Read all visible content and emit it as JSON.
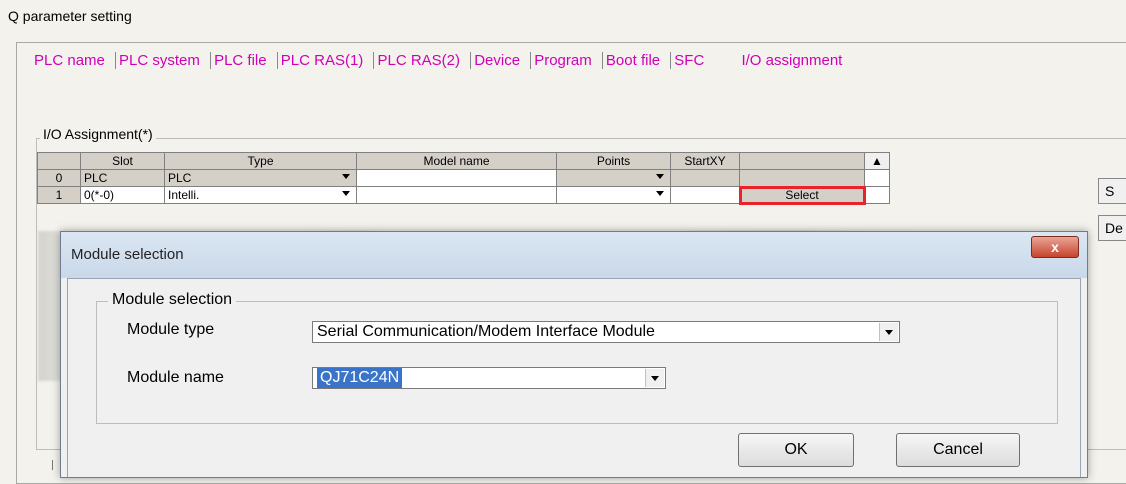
{
  "window": {
    "title": "Q parameter setting"
  },
  "tabs": [
    {
      "label": "PLC name"
    },
    {
      "label": "PLC system"
    },
    {
      "label": "PLC file"
    },
    {
      "label": "PLC RAS(1)"
    },
    {
      "label": "PLC RAS(2)"
    },
    {
      "label": "Device"
    },
    {
      "label": "Program"
    },
    {
      "label": "Boot file"
    },
    {
      "label": "SFC"
    },
    {
      "label": "I/O assignment"
    }
  ],
  "io": {
    "group_label": "I/O Assignment(*)",
    "columns": [
      "Slot",
      "Type",
      "Model name",
      "Points",
      "StartXY"
    ],
    "rows": [
      {
        "index": "0",
        "slot": "PLC",
        "type": "PLC",
        "model": "",
        "points": "",
        "start": ""
      },
      {
        "index": "1",
        "slot": "0(*-0)",
        "type": "Intelli.",
        "model": "",
        "points": "",
        "start": "",
        "action": "Select"
      }
    ]
  },
  "side_buttons": [
    "S",
    "De"
  ],
  "dialog": {
    "title": "Module selection",
    "group_label": "Module selection",
    "module_type_label": "Module type",
    "module_type_value": "Serial Communication/Modem Interface Module",
    "module_name_label": "Module name",
    "module_name_value": "QJ71C24N",
    "ok_label": "OK",
    "cancel_label": "Cancel",
    "close_label": "x"
  }
}
